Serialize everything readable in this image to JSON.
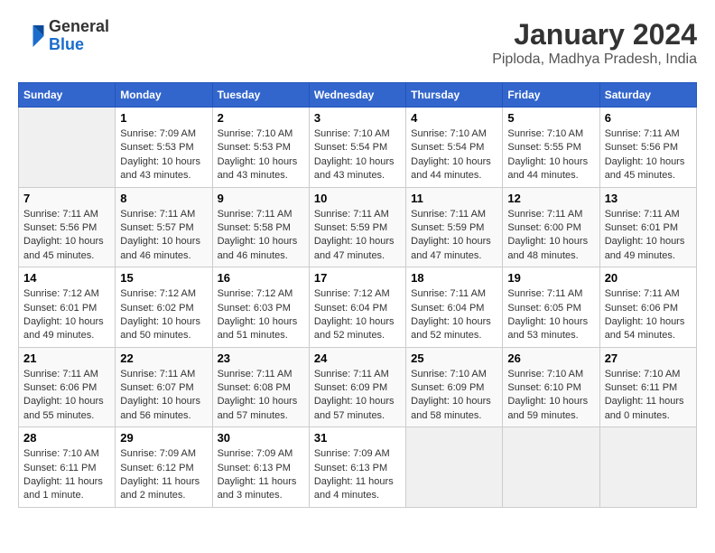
{
  "logo": {
    "general": "General",
    "blue": "Blue"
  },
  "title": "January 2024",
  "subtitle": "Piploda, Madhya Pradesh, India",
  "days_of_week": [
    "Sunday",
    "Monday",
    "Tuesday",
    "Wednesday",
    "Thursday",
    "Friday",
    "Saturday"
  ],
  "weeks": [
    [
      {
        "day": "",
        "info": ""
      },
      {
        "day": "1",
        "info": "Sunrise: 7:09 AM\nSunset: 5:53 PM\nDaylight: 10 hours\nand 43 minutes."
      },
      {
        "day": "2",
        "info": "Sunrise: 7:10 AM\nSunset: 5:53 PM\nDaylight: 10 hours\nand 43 minutes."
      },
      {
        "day": "3",
        "info": "Sunrise: 7:10 AM\nSunset: 5:54 PM\nDaylight: 10 hours\nand 43 minutes."
      },
      {
        "day": "4",
        "info": "Sunrise: 7:10 AM\nSunset: 5:54 PM\nDaylight: 10 hours\nand 44 minutes."
      },
      {
        "day": "5",
        "info": "Sunrise: 7:10 AM\nSunset: 5:55 PM\nDaylight: 10 hours\nand 44 minutes."
      },
      {
        "day": "6",
        "info": "Sunrise: 7:11 AM\nSunset: 5:56 PM\nDaylight: 10 hours\nand 45 minutes."
      }
    ],
    [
      {
        "day": "7",
        "info": "Sunrise: 7:11 AM\nSunset: 5:56 PM\nDaylight: 10 hours\nand 45 minutes."
      },
      {
        "day": "8",
        "info": "Sunrise: 7:11 AM\nSunset: 5:57 PM\nDaylight: 10 hours\nand 46 minutes."
      },
      {
        "day": "9",
        "info": "Sunrise: 7:11 AM\nSunset: 5:58 PM\nDaylight: 10 hours\nand 46 minutes."
      },
      {
        "day": "10",
        "info": "Sunrise: 7:11 AM\nSunset: 5:59 PM\nDaylight: 10 hours\nand 47 minutes."
      },
      {
        "day": "11",
        "info": "Sunrise: 7:11 AM\nSunset: 5:59 PM\nDaylight: 10 hours\nand 47 minutes."
      },
      {
        "day": "12",
        "info": "Sunrise: 7:11 AM\nSunset: 6:00 PM\nDaylight: 10 hours\nand 48 minutes."
      },
      {
        "day": "13",
        "info": "Sunrise: 7:11 AM\nSunset: 6:01 PM\nDaylight: 10 hours\nand 49 minutes."
      }
    ],
    [
      {
        "day": "14",
        "info": "Sunrise: 7:12 AM\nSunset: 6:01 PM\nDaylight: 10 hours\nand 49 minutes."
      },
      {
        "day": "15",
        "info": "Sunrise: 7:12 AM\nSunset: 6:02 PM\nDaylight: 10 hours\nand 50 minutes."
      },
      {
        "day": "16",
        "info": "Sunrise: 7:12 AM\nSunset: 6:03 PM\nDaylight: 10 hours\nand 51 minutes."
      },
      {
        "day": "17",
        "info": "Sunrise: 7:12 AM\nSunset: 6:04 PM\nDaylight: 10 hours\nand 52 minutes."
      },
      {
        "day": "18",
        "info": "Sunrise: 7:11 AM\nSunset: 6:04 PM\nDaylight: 10 hours\nand 52 minutes."
      },
      {
        "day": "19",
        "info": "Sunrise: 7:11 AM\nSunset: 6:05 PM\nDaylight: 10 hours\nand 53 minutes."
      },
      {
        "day": "20",
        "info": "Sunrise: 7:11 AM\nSunset: 6:06 PM\nDaylight: 10 hours\nand 54 minutes."
      }
    ],
    [
      {
        "day": "21",
        "info": "Sunrise: 7:11 AM\nSunset: 6:06 PM\nDaylight: 10 hours\nand 55 minutes."
      },
      {
        "day": "22",
        "info": "Sunrise: 7:11 AM\nSunset: 6:07 PM\nDaylight: 10 hours\nand 56 minutes."
      },
      {
        "day": "23",
        "info": "Sunrise: 7:11 AM\nSunset: 6:08 PM\nDaylight: 10 hours\nand 57 minutes."
      },
      {
        "day": "24",
        "info": "Sunrise: 7:11 AM\nSunset: 6:09 PM\nDaylight: 10 hours\nand 57 minutes."
      },
      {
        "day": "25",
        "info": "Sunrise: 7:10 AM\nSunset: 6:09 PM\nDaylight: 10 hours\nand 58 minutes."
      },
      {
        "day": "26",
        "info": "Sunrise: 7:10 AM\nSunset: 6:10 PM\nDaylight: 10 hours\nand 59 minutes."
      },
      {
        "day": "27",
        "info": "Sunrise: 7:10 AM\nSunset: 6:11 PM\nDaylight: 11 hours\nand 0 minutes."
      }
    ],
    [
      {
        "day": "28",
        "info": "Sunrise: 7:10 AM\nSunset: 6:11 PM\nDaylight: 11 hours\nand 1 minute."
      },
      {
        "day": "29",
        "info": "Sunrise: 7:09 AM\nSunset: 6:12 PM\nDaylight: 11 hours\nand 2 minutes."
      },
      {
        "day": "30",
        "info": "Sunrise: 7:09 AM\nSunset: 6:13 PM\nDaylight: 11 hours\nand 3 minutes."
      },
      {
        "day": "31",
        "info": "Sunrise: 7:09 AM\nSunset: 6:13 PM\nDaylight: 11 hours\nand 4 minutes."
      },
      {
        "day": "",
        "info": ""
      },
      {
        "day": "",
        "info": ""
      },
      {
        "day": "",
        "info": ""
      }
    ]
  ]
}
